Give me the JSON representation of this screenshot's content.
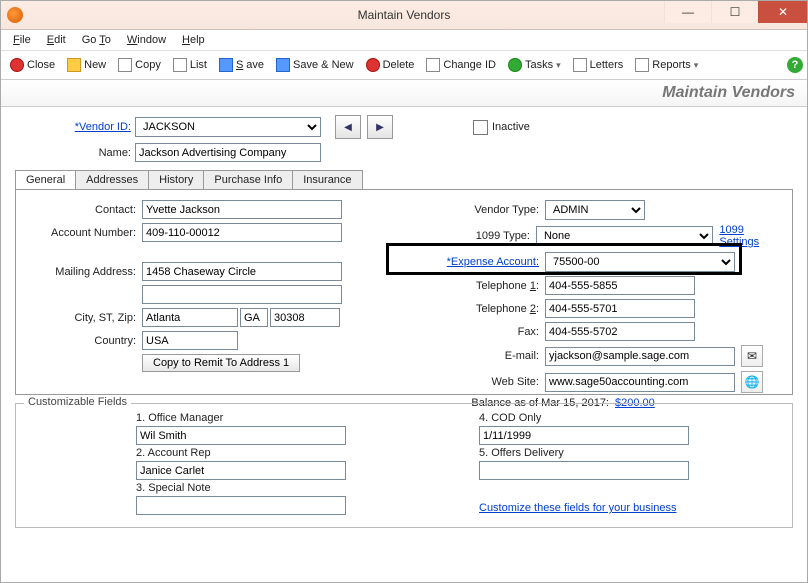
{
  "window": {
    "title": "Maintain Vendors"
  },
  "menu": {
    "file": "File",
    "edit": "Edit",
    "goto": "Go To",
    "window": "Window",
    "help": "Help"
  },
  "toolbar": {
    "close": "Close",
    "new": "New",
    "copy": "Copy",
    "list": "List",
    "save": "Save",
    "savenew": "Save & New",
    "delete": "Delete",
    "changeid": "Change ID",
    "tasks": "Tasks",
    "letters": "Letters",
    "reports": "Reports"
  },
  "pageTitle": "Maintain Vendors",
  "header": {
    "vendorIdLabel": "*Vendor ID:",
    "vendorId": "JACKSON",
    "nameLabel": "Name:",
    "name": "Jackson Advertising Company",
    "inactive": "Inactive"
  },
  "tabs": {
    "general": "General",
    "addresses": "Addresses",
    "history": "History",
    "purchase": "Purchase Info",
    "insurance": "Insurance"
  },
  "general": {
    "contactLabel": "Contact:",
    "contact": "Yvette Jackson",
    "acctNumLabel": "Account Number:",
    "acctNum": "409-110-00012",
    "mailLabel": "Mailing Address:",
    "mail1": "1458 Chaseway Circle",
    "mail2": "",
    "cszLabel": "City, ST, Zip:",
    "city": "Atlanta",
    "st": "GA",
    "zip": "30308",
    "countryLabel": "Country:",
    "country": "USA",
    "copyBtn": "Copy to Remit To Address 1",
    "vendorTypeLabel": "Vendor Type:",
    "vendorType": "ADMIN",
    "type1099Label": "1099 Type:",
    "type1099": "None",
    "settings1099": "1099 Settings",
    "expAcctLabel": "*Expense Account:",
    "expAcct": "75500-00",
    "tel1Label": "Telephone 1:",
    "tel1": "404-555-5855",
    "tel2Label": "Telephone 2:",
    "tel2": "404-555-5701",
    "faxLabel": "Fax:",
    "fax": "404-555-5702",
    "emailLabel": "E-mail:",
    "email": "yjackson@sample.sage.com",
    "webLabel": "Web Site:",
    "web": "www.sage50accounting.com",
    "balanceLabel": "Balance as of Mar 15, 2017:",
    "balance": "$200.00"
  },
  "custom": {
    "legend": "Customizable Fields",
    "f1": "1. Office Manager",
    "v1": "Wil Smith",
    "f2": "2. Account Rep",
    "v2": "Janice Carlet",
    "f3": "3. Special Note",
    "v3": "",
    "f4": "4. COD Only",
    "v4": "1/11/1999",
    "f5": "5. Offers Delivery",
    "v5": "",
    "customizeLink": "Customize these fields for your business"
  }
}
